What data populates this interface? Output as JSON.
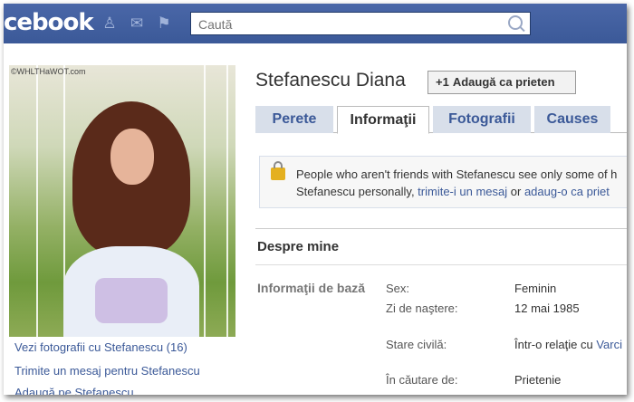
{
  "topbar": {
    "logo": "cebook",
    "search_placeholder": "Caută"
  },
  "photo": {
    "watermark": "©WHLTHaWOT.com"
  },
  "left_links": [
    "Vezi fotografii cu Stefanescu (16)",
    "Trimite un mesaj pentru Stefanescu",
    "Adaugă pe Stefanescu"
  ],
  "profile": {
    "name": "Stefanescu Diana",
    "add_friend_plus": "+1",
    "add_friend_label": "Adaugă ca prieten"
  },
  "tabs": [
    {
      "label": "Perete",
      "active": false
    },
    {
      "label": "Informaţii",
      "active": true
    },
    {
      "label": "Fotografii",
      "active": false
    },
    {
      "label": "Causes",
      "active": false
    }
  ],
  "notice": {
    "line1": "People who aren't friends with Stefanescu see only some of h",
    "line2_prefix": "Stefanescu personally, ",
    "link1": "trimite-i un mesaj",
    "middle": " or ",
    "link2": "adaug-o ca priet"
  },
  "about": {
    "title": "Despre mine",
    "section": "Informaţii de bază",
    "rows": [
      {
        "label": "Sex:",
        "value": "Feminin"
      },
      {
        "label": "Zi de naştere:",
        "value": "12 mai 1985"
      },
      {
        "label": "Stare civilă:",
        "value": "Într-o relaţie cu ",
        "link": "Varci"
      },
      {
        "label": "În căutare de:",
        "value": "Prietenie"
      }
    ]
  }
}
